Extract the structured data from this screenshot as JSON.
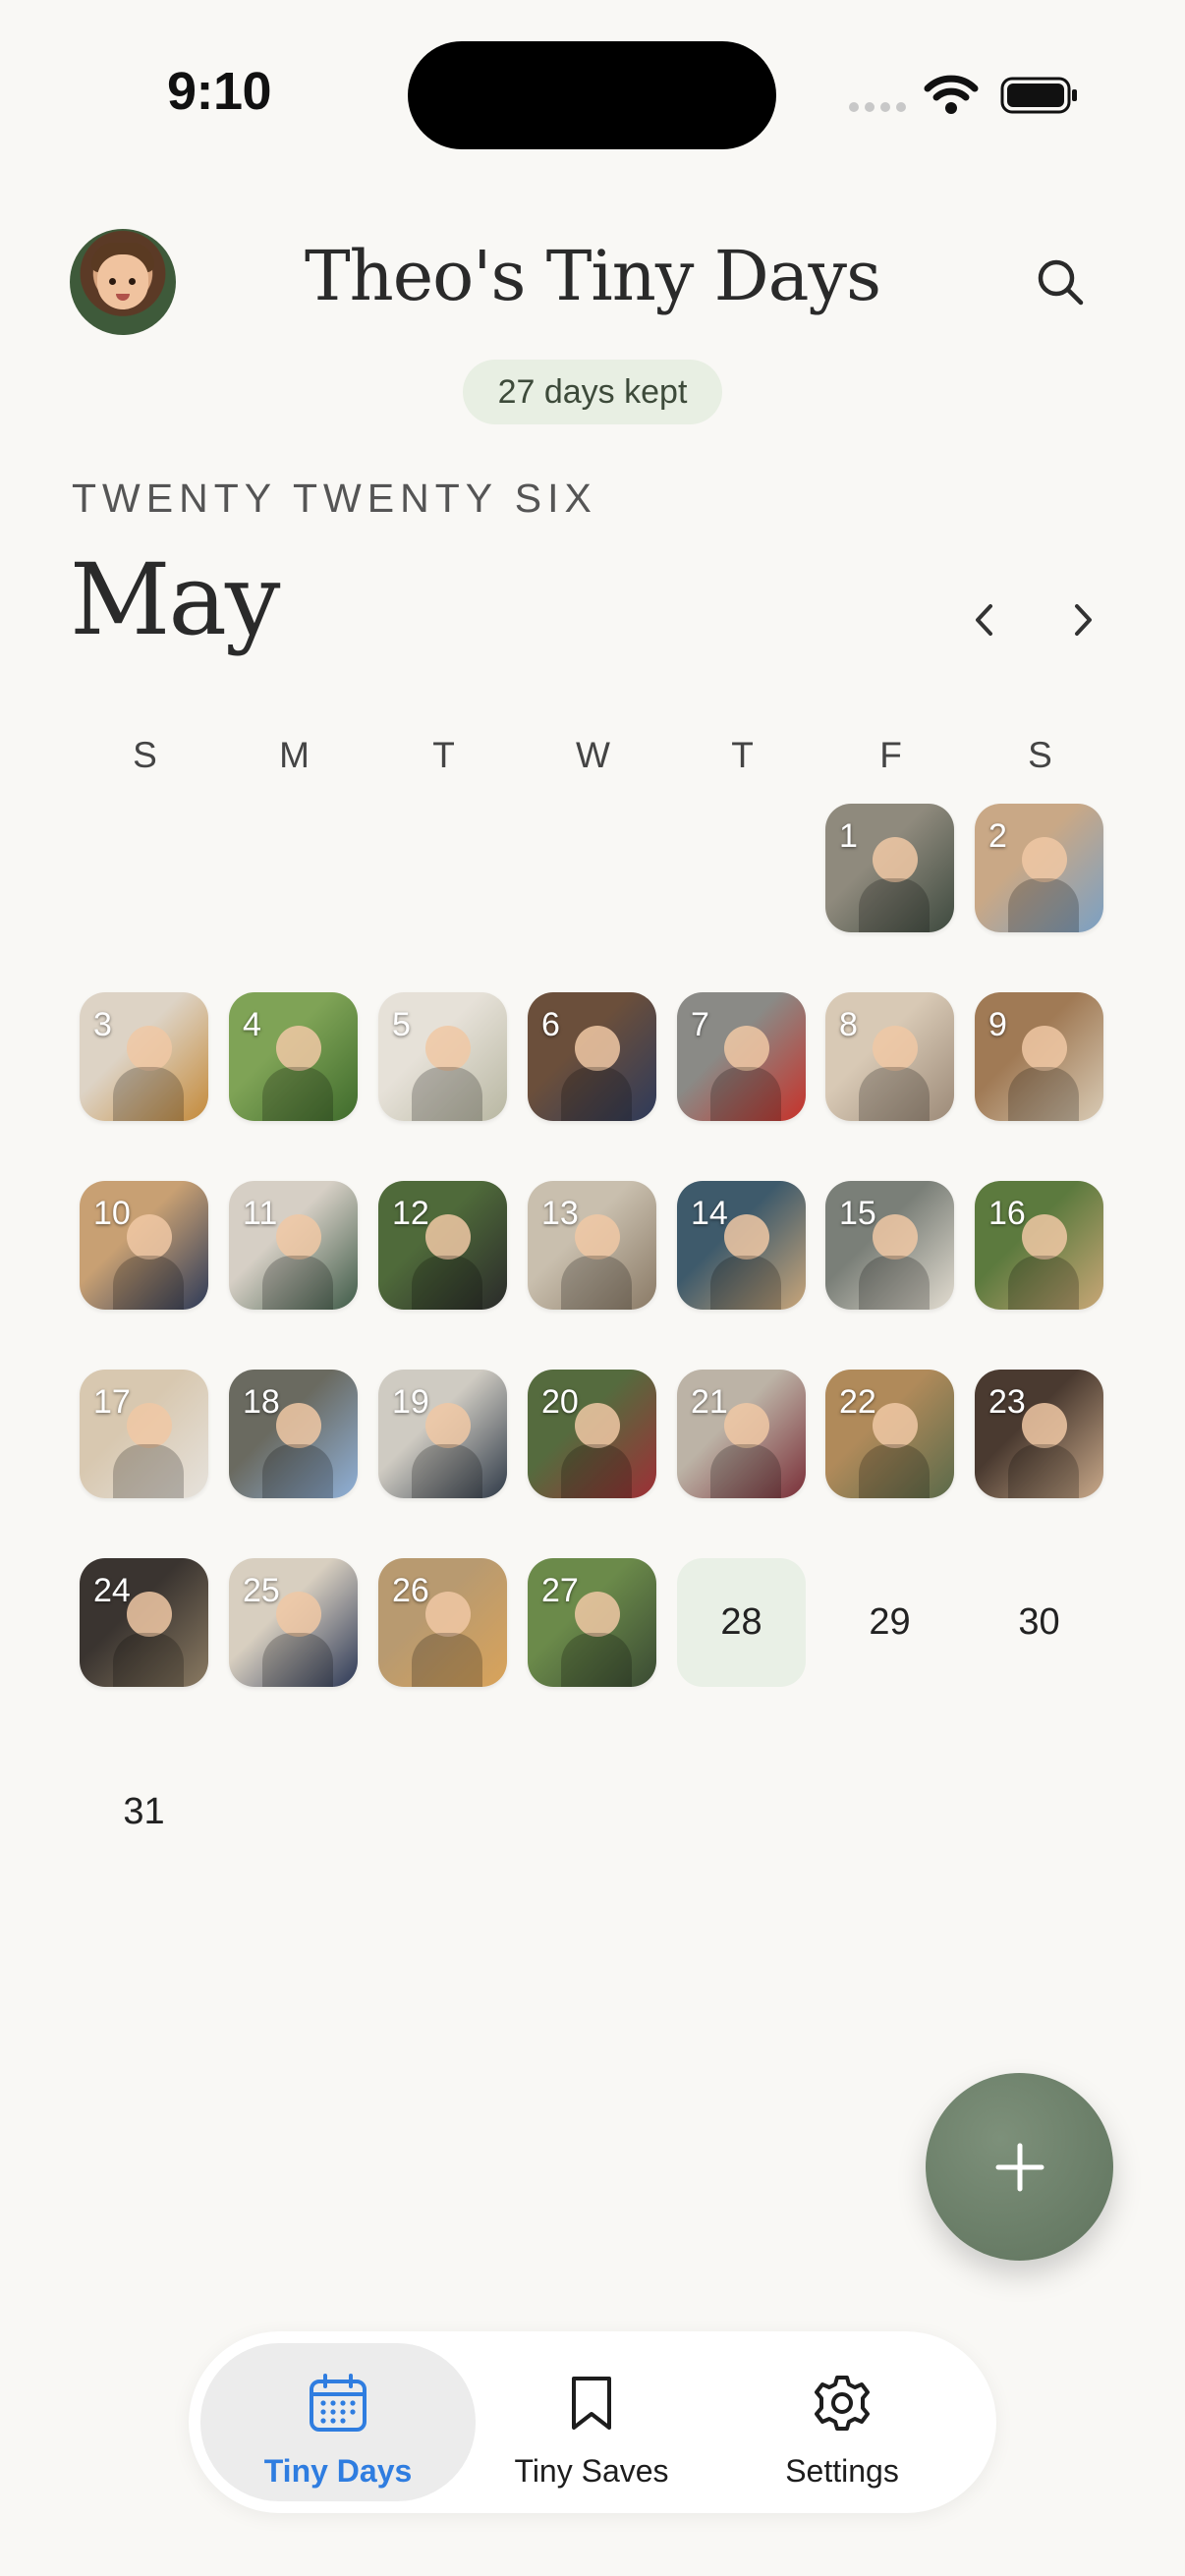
{
  "status_bar": {
    "time": "9:10"
  },
  "header": {
    "title": "Theo's Tiny Days",
    "badge": "27 days kept",
    "year_label": "TWENTY TWENTY SIX",
    "month_label": "May"
  },
  "calendar": {
    "weekdays": [
      "S",
      "M",
      "T",
      "W",
      "T",
      "F",
      "S"
    ],
    "today": 28,
    "days": [
      {
        "n": "1",
        "photo": true,
        "c": [
          "#8f8a7d",
          "#3e4a3f"
        ]
      },
      {
        "n": "2",
        "photo": true,
        "c": [
          "#c9a886",
          "#7aa0c4"
        ]
      },
      {
        "n": "3",
        "photo": true,
        "c": [
          "#ddd3c5",
          "#c48a3a"
        ]
      },
      {
        "n": "4",
        "photo": true,
        "c": [
          "#7fa356",
          "#3f6b2c"
        ]
      },
      {
        "n": "5",
        "photo": true,
        "c": [
          "#e6e1d8",
          "#b8b7a2"
        ]
      },
      {
        "n": "6",
        "photo": true,
        "c": [
          "#6b4f3b",
          "#2e3a5a"
        ]
      },
      {
        "n": "7",
        "photo": true,
        "c": [
          "#8a8a86",
          "#c7322a"
        ]
      },
      {
        "n": "8",
        "photo": true,
        "c": [
          "#d8c9b5",
          "#9c8a78"
        ]
      },
      {
        "n": "9",
        "photo": true,
        "c": [
          "#a07a55",
          "#d9cbb5"
        ]
      },
      {
        "n": "10",
        "photo": true,
        "c": [
          "#c8a073",
          "#2d3a58"
        ]
      },
      {
        "n": "11",
        "photo": true,
        "c": [
          "#d6cfc5",
          "#3f5b48"
        ]
      },
      {
        "n": "12",
        "photo": true,
        "c": [
          "#4f6a3a",
          "#2a2a2a"
        ]
      },
      {
        "n": "13",
        "photo": true,
        "c": [
          "#c9bfae",
          "#8a7a66"
        ]
      },
      {
        "n": "14",
        "photo": true,
        "c": [
          "#3e5a6b",
          "#c9a67a"
        ]
      },
      {
        "n": "15",
        "photo": true,
        "c": [
          "#7a7f78",
          "#e2dcd0"
        ]
      },
      {
        "n": "16",
        "photo": true,
        "c": [
          "#5c7a3e",
          "#c9a777"
        ]
      },
      {
        "n": "17",
        "photo": true,
        "c": [
          "#d8c8b0",
          "#e6e2dc"
        ]
      },
      {
        "n": "18",
        "photo": true,
        "c": [
          "#6a6a60",
          "#8fb0d8"
        ]
      },
      {
        "n": "19",
        "photo": true,
        "c": [
          "#cfcbc2",
          "#2f3a48"
        ]
      },
      {
        "n": "20",
        "photo": true,
        "c": [
          "#556b3e",
          "#9e2f36"
        ]
      },
      {
        "n": "21",
        "photo": true,
        "c": [
          "#bcb3a6",
          "#7a2f38"
        ]
      },
      {
        "n": "22",
        "photo": true,
        "c": [
          "#b08a5a",
          "#5a6a4a"
        ]
      },
      {
        "n": "23",
        "photo": true,
        "c": [
          "#4a3a30",
          "#c9a98a"
        ]
      },
      {
        "n": "24",
        "photo": true,
        "c": [
          "#3a3430",
          "#8a7a62"
        ]
      },
      {
        "n": "25",
        "photo": true,
        "c": [
          "#d8cfc0",
          "#2c3856"
        ]
      },
      {
        "n": "26",
        "photo": true,
        "c": [
          "#b89a70",
          "#d9a35a"
        ]
      },
      {
        "n": "27",
        "photo": true,
        "c": [
          "#6b8a4a",
          "#3a4a33"
        ]
      },
      {
        "n": "28",
        "photo": false
      },
      {
        "n": "29",
        "photo": false
      },
      {
        "n": "30",
        "photo": false
      },
      {
        "n": "31",
        "photo": false
      }
    ]
  },
  "fab_icon": "plus-icon",
  "tabs": [
    {
      "label": "Tiny Days",
      "icon": "calendar-icon",
      "active": true
    },
    {
      "label": "Tiny Saves",
      "icon": "bookmark-icon",
      "active": false
    },
    {
      "label": "Settings",
      "icon": "gear-icon",
      "active": false
    }
  ],
  "colors": {
    "accent": "#2f7de0",
    "today_bg": "#e9f0e6",
    "fab": "#6f836c",
    "background": "#f9f8f5"
  }
}
